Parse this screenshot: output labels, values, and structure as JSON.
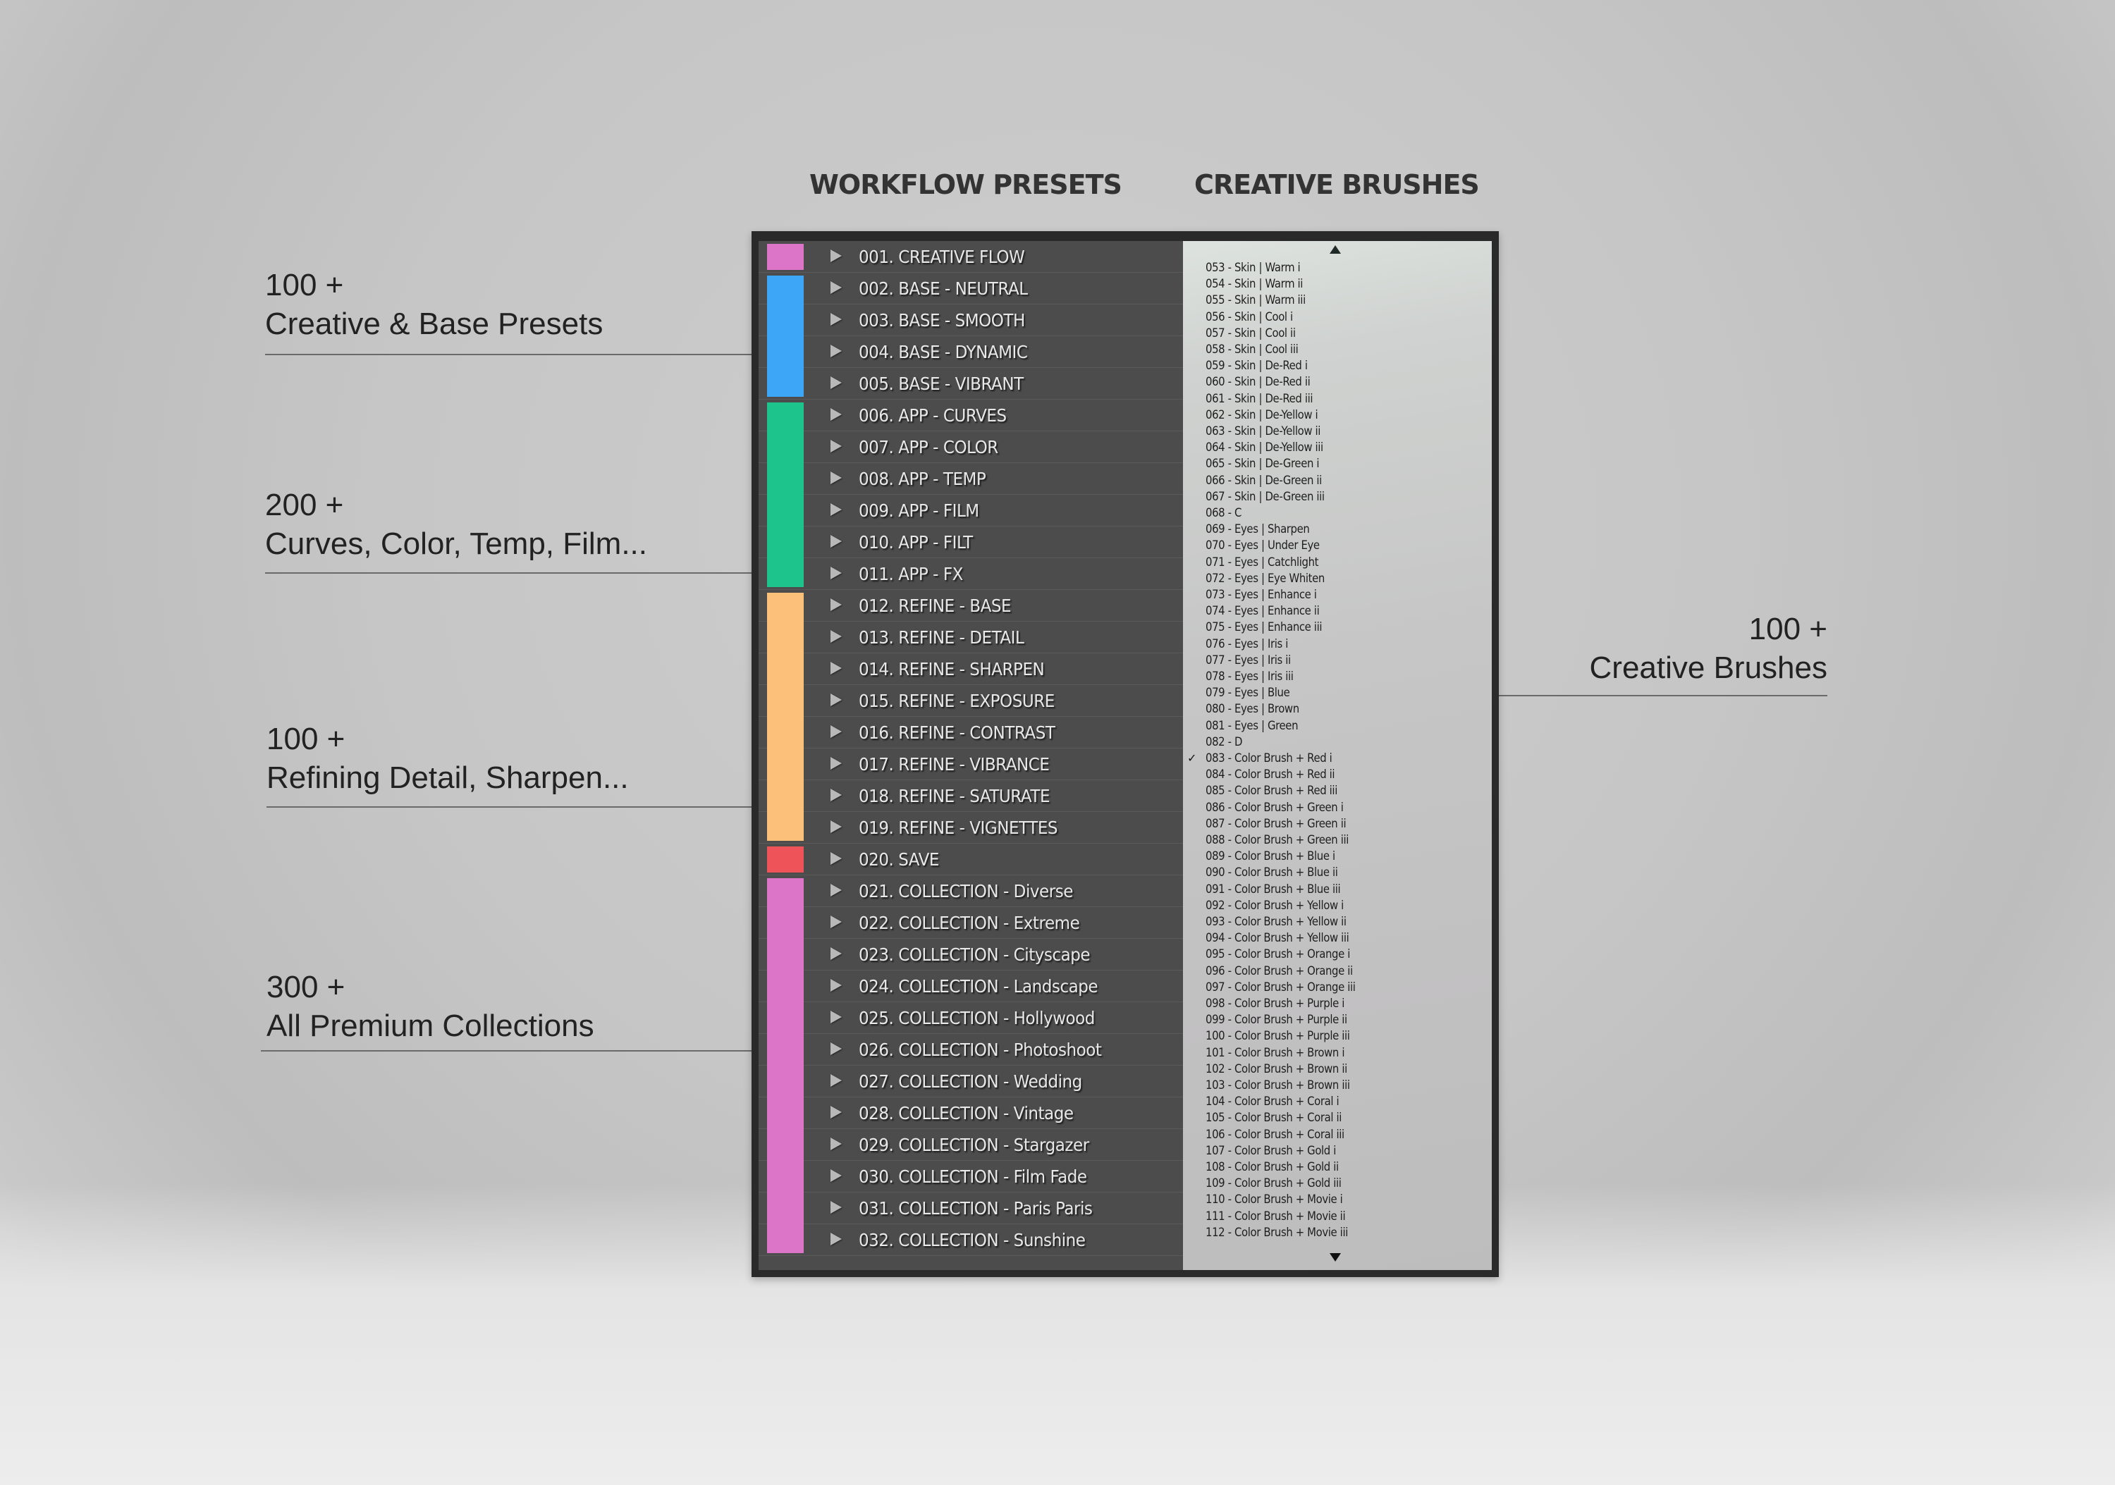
{
  "headers": {
    "presets": "WORKFLOW PRESETS",
    "brushes": "CREATIVE BRUSHES"
  },
  "colors": {
    "pink": "#dc74c8",
    "blue": "#3ea6f7",
    "green": "#1dc48b",
    "orange": "#fdc07a",
    "red": "#ef535a"
  },
  "swatch_groups": [
    {
      "color": "#dc74c8",
      "from": 1,
      "to": 1
    },
    {
      "color": "#3ea6f7",
      "from": 2,
      "to": 5
    },
    {
      "color": "#1dc48b",
      "from": 6,
      "to": 11
    },
    {
      "color": "#fdc07a",
      "from": 12,
      "to": 19
    },
    {
      "color": "#ef535a",
      "from": 20,
      "to": 20
    },
    {
      "color": "#dc74c8",
      "from": 21,
      "to": 32
    }
  ],
  "presets": [
    "001. CREATIVE FLOW",
    "002. BASE - NEUTRAL",
    "003. BASE - SMOOTH",
    "004. BASE - DYNAMIC",
    "005. BASE - VIBRANT",
    "006. APP - CURVES",
    "007. APP - COLOR",
    "008. APP - TEMP",
    "009. APP - FILM",
    "010. APP - FILT",
    "011. APP - FX",
    "012. REFINE - BASE",
    "013. REFINE - DETAIL",
    "014. REFINE - SHARPEN",
    "015. REFINE - EXPOSURE",
    "016. REFINE - CONTRAST",
    "017. REFINE - VIBRANCE",
    "018. REFINE - SATURATE",
    "019. REFINE - VIGNETTES",
    "020. SAVE",
    "021. COLLECTION - Diverse",
    "022. COLLECTION - Extreme",
    "023. COLLECTION - Cityscape",
    "024. COLLECTION - Landscape",
    "025. COLLECTION - Hollywood",
    "026. COLLECTION - Photoshoot",
    "027. COLLECTION - Wedding",
    "028. COLLECTION - Vintage",
    "029. COLLECTION - Stargazer",
    "030. COLLECTION - Film Fade",
    "031. COLLECTION - Paris Paris",
    "032. COLLECTION - Sunshine"
  ],
  "brushes": {
    "checked": "083 - Color Brush + Red i",
    "check_mark": "✓",
    "items": [
      "053 - Skin | Warm i",
      "054 - Skin | Warm ii",
      "055 - Skin | Warm iii",
      "056 - Skin | Cool i",
      "057 - Skin | Cool ii",
      "058 - Skin | Cool iii",
      "059 - Skin | De-Red i",
      "060 - Skin | De-Red ii",
      "061 - Skin | De-Red iii",
      "062 - Skin | De-Yellow i",
      "063 - Skin | De-Yellow ii",
      "064 - Skin | De-Yellow iii",
      "065 - Skin | De-Green i",
      "066 - Skin | De-Green ii",
      "067 - Skin | De-Green iii",
      "068 - C",
      "069 - Eyes | Sharpen",
      "070 - Eyes | Under Eye",
      "071 - Eyes | Catchlight",
      "072 - Eyes | Eye Whiten",
      "073 - Eyes | Enhance i",
      "074 - Eyes | Enhance ii",
      "075 - Eyes | Enhance iii",
      "076 - Eyes | Iris i",
      "077 - Eyes | Iris ii",
      "078 - Eyes | Iris iii",
      "079 - Eyes | Blue",
      "080 - Eyes | Brown",
      "081 - Eyes | Green",
      "082 - D",
      "083 - Color Brush + Red i",
      "084 - Color Brush + Red ii",
      "085 - Color Brush + Red iii",
      "086 - Color Brush + Green i",
      "087 - Color Brush + Green ii",
      "088 - Color Brush + Green iii",
      "089 - Color Brush + Blue i",
      "090 - Color Brush + Blue ii",
      "091 - Color Brush + Blue iii",
      "092 - Color Brush + Yellow i",
      "093 - Color Brush + Yellow ii",
      "094 - Color Brush + Yellow iii",
      "095 - Color Brush + Orange i",
      "096 - Color Brush + Orange ii",
      "097 - Color Brush + Orange iii",
      "098 - Color Brush + Purple i",
      "099 - Color Brush + Purple ii",
      "100 - Color Brush + Purple iii",
      "101 - Color Brush + Brown i",
      "102 - Color Brush + Brown ii",
      "103 - Color Brush + Brown iii",
      "104 - Color Brush + Coral i",
      "105 - Color Brush + Coral ii",
      "106 - Color Brush + Coral iii",
      "107 - Color Brush + Gold i",
      "108 - Color Brush + Gold ii",
      "109 - Color Brush + Gold iii",
      "110 - Color Brush + Movie i",
      "111 - Color Brush + Movie ii",
      "112 - Color Brush + Movie iii"
    ]
  },
  "callouts": [
    {
      "count": "100 +",
      "label": "Creative & Base Presets"
    },
    {
      "count": "200 +",
      "label": "Curves, Color, Temp, Film..."
    },
    {
      "count": "100 +",
      "label": "Refining Detail, Sharpen..."
    },
    {
      "count": "300 +",
      "label": "All Premium Collections"
    },
    {
      "count": "100 +",
      "label": "Creative Brushes"
    }
  ]
}
